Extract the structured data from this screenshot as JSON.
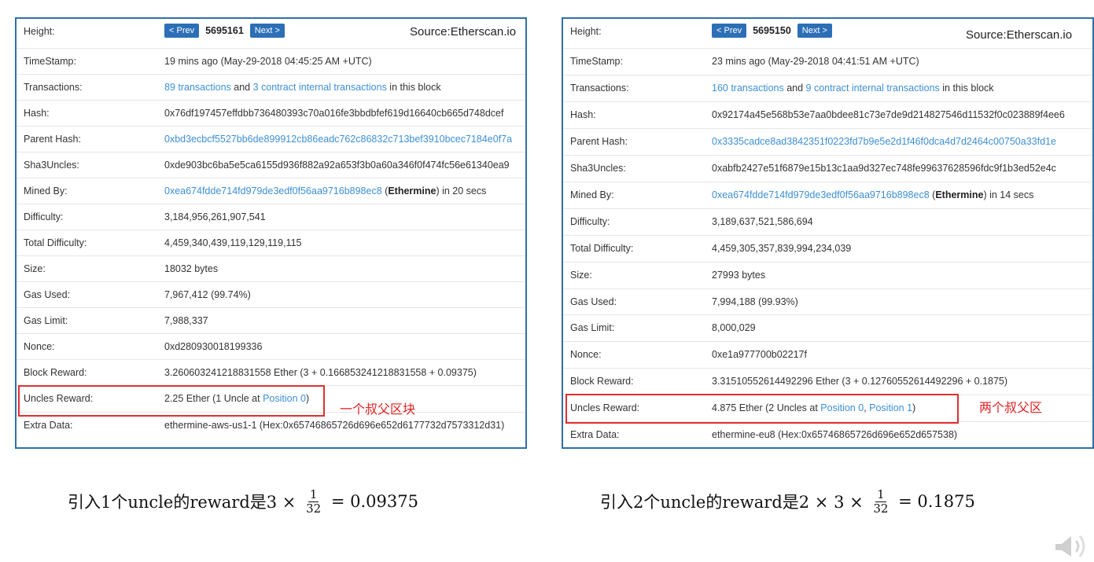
{
  "left": {
    "prev_label": "< Prev",
    "next_label": "Next >",
    "block_number": "5695161",
    "source": "Source:Etherscan.io",
    "rows": {
      "height": {
        "label": "Height:"
      },
      "timestamp": {
        "label": "TimeStamp:",
        "value": "19 mins ago (May-29-2018 04:45:25 AM +UTC)"
      },
      "transactions": {
        "label": "Transactions:",
        "tx_link": "89 transactions",
        "and": " and ",
        "internal_link": "3 contract internal transactions",
        "suffix": " in this block"
      },
      "hash": {
        "label": "Hash:",
        "value": "0x76df197457effdbb736480393c70a016fe3bbdbfef619d16640cb665d748dcef"
      },
      "parent_hash": {
        "label": "Parent Hash:",
        "value": "0xbd3ecbcf5527bb6de899912cb86eadc762c86832c713bef3910bcec7184e0f7a"
      },
      "sha3uncles": {
        "label": "Sha3Uncles:",
        "value": "0xde903bc6ba5e5ca6155d936f882a92a653f3b0a60a346f0f474fc56e61340ea9"
      },
      "mined_by": {
        "label": "Mined By:",
        "address": "0xea674fdde714fd979de3edf0f56aa9716b898ec8",
        "pool_open": " (",
        "pool": "Ethermine",
        "pool_close": ")",
        "time": " in 20 secs"
      },
      "difficulty": {
        "label": "Difficulty:",
        "value": "3,184,956,261,907,541"
      },
      "total_difficulty": {
        "label": "Total Difficulty:",
        "value": "4,459,340,439,119,129,119,115"
      },
      "size": {
        "label": "Size:",
        "value": "18032 bytes"
      },
      "gas_used": {
        "label": "Gas Used:",
        "value": "7,967,412 (99.74%)"
      },
      "gas_limit": {
        "label": "Gas Limit:",
        "value": "7,988,337"
      },
      "nonce": {
        "label": "Nonce:",
        "value": "0xd280930018199336"
      },
      "block_reward": {
        "label": "Block Reward:",
        "value": "3.260603241218831558 Ether (3 + 0.166853241218831558 + 0.09375)"
      },
      "uncles_reward": {
        "label": "Uncles Reward:",
        "prefix": "2.25 Ether (1 Uncle at ",
        "pos0": "Position 0",
        "suffix": ")"
      },
      "extra_data": {
        "label": "Extra Data:",
        "value": "ethermine-aws-us1-1 (Hex:0x65746865726d696e652d6177732d7573312d31)"
      }
    },
    "note": "一个叔父区块",
    "formula": {
      "prefix": "引入1个uncle的reward是3 × ",
      "numerator": "1",
      "denominator": "32",
      "suffix": " = 0.09375"
    }
  },
  "right": {
    "prev_label": "< Prev",
    "next_label": "Next >",
    "block_number": "5695150",
    "source": "Source:Etherscan.io",
    "rows": {
      "height": {
        "label": "Height:"
      },
      "timestamp": {
        "label": "TimeStamp:",
        "value": "23 mins ago (May-29-2018 04:41:51 AM +UTC)"
      },
      "transactions": {
        "label": "Transactions:",
        "tx_link": "160 transactions",
        "and": " and ",
        "internal_link": "9 contract internal transactions",
        "suffix": " in this block"
      },
      "hash": {
        "label": "Hash:",
        "value": "0x92174a45e568b53e7aa0bdee81c73e7de9d214827546d11532f0c023889f4ee6"
      },
      "parent_hash": {
        "label": "Parent Hash:",
        "value": "0x3335cadce8ad3842351f0223fd7b9e5e2d1f46f0dca4d7d2464c00750a33fd1e"
      },
      "sha3uncles": {
        "label": "Sha3Uncles:",
        "value": "0xabfb2427e51f6879e15b13c1aa9d327ec748fe99637628596fdc9f1b3ed52e4c"
      },
      "mined_by": {
        "label": "Mined By:",
        "address": "0xea674fdde714fd979de3edf0f56aa9716b898ec8",
        "pool_open": " (",
        "pool": "Ethermine",
        "pool_close": ")",
        "time": " in 14 secs"
      },
      "difficulty": {
        "label": "Difficulty:",
        "value": "3,189,637,521,586,694"
      },
      "total_difficulty": {
        "label": "Total Difficulty:",
        "value": "4,459,305,357,839,994,234,039"
      },
      "size": {
        "label": "Size:",
        "value": "27993 bytes"
      },
      "gas_used": {
        "label": "Gas Used:",
        "value": "7,994,188 (99.93%)"
      },
      "gas_limit": {
        "label": "Gas Limit:",
        "value": "8,000,029"
      },
      "nonce": {
        "label": "Nonce:",
        "value": "0xe1a977700b02217f"
      },
      "block_reward": {
        "label": "Block Reward:",
        "value": "3.31510552614492296 Ether (3 + 0.12760552614492296 + 0.1875)"
      },
      "uncles_reward": {
        "label": "Uncles Reward:",
        "prefix": "4.875 Ether (2 Uncles at ",
        "pos0": "Position 0",
        "sep": ", ",
        "pos1": "Position 1",
        "suffix": ")"
      },
      "extra_data": {
        "label": "Extra Data:",
        "value": "ethermine-eu8 (Hex:0x65746865726d696e652d657538)"
      }
    },
    "note": "两个叔父区",
    "formula": {
      "prefix": "引入2个uncle的reward是2 × 3 × ",
      "numerator": "1",
      "denominator": "32",
      "suffix": " = 0.1875"
    }
  },
  "icons": {
    "speaker": "speaker-icon"
  }
}
